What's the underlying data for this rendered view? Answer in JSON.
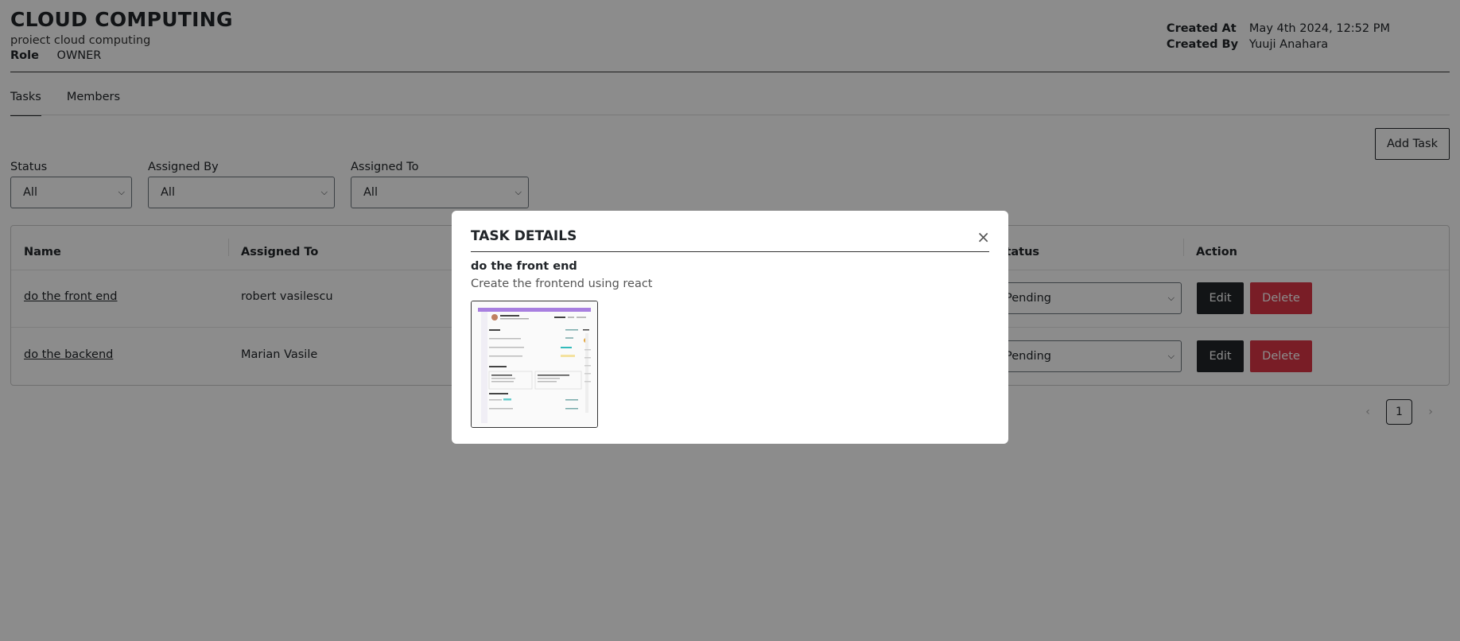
{
  "project": {
    "title": "CLOUD COMPUTING",
    "subtitle": "proiect cloud computing",
    "role_label": "Role",
    "role_value": "OWNER",
    "created_at_label": "Created At",
    "created_at_value": "May 4th 2024, 12:52 PM",
    "created_by_label": "Created By",
    "created_by_value": "Yuuji Anahara"
  },
  "tabs": [
    {
      "label": "Tasks",
      "active": true
    },
    {
      "label": "Members",
      "active": false
    }
  ],
  "toolbar": {
    "add_task_label": "Add Task"
  },
  "filters": [
    {
      "label": "Status",
      "value": "All"
    },
    {
      "label": "Assigned By",
      "value": "All"
    },
    {
      "label": "Assigned To",
      "value": "All"
    }
  ],
  "table": {
    "headers": [
      "Name",
      "Assigned To",
      "Status",
      "Action"
    ],
    "rows": [
      {
        "name": "do the front end",
        "assigned_to": "robert vasilescu",
        "status": "Pending"
      },
      {
        "name": "do the backend",
        "assigned_to": "Marian Vasile",
        "status": "Pending"
      }
    ],
    "edit_label": "Edit",
    "delete_label": "Delete"
  },
  "pagination": {
    "current_page": "1",
    "prev_icon": "chevron-left-icon",
    "next_icon": "chevron-right-icon"
  },
  "modal": {
    "title": "TASK DETAILS",
    "close_glyph": "×",
    "task_name": "do the front end",
    "task_description": "Create the frontend using react"
  },
  "colors": {
    "dark": "#212529",
    "danger": "#dc3545",
    "overlay": "rgba(0,0,0,0.45)",
    "thumb_accent": "#a87fe0"
  }
}
